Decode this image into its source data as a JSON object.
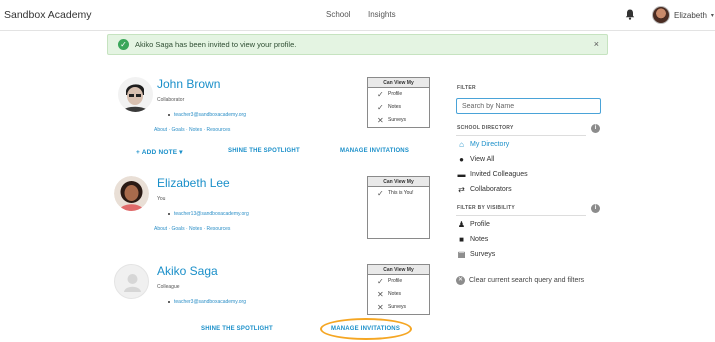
{
  "header": {
    "brand": "Sandbox Academy",
    "nav": [
      "School",
      "Insights"
    ],
    "user_name": "Elizabeth",
    "caret": "▾"
  },
  "alert": {
    "message": "Akiko Saga has been invited to view your profile.",
    "close": "×"
  },
  "people": [
    {
      "name": "John Brown",
      "role": "Collaborator",
      "email": "teacher3@sandboxacademy.org",
      "links": "About · Goals · Notes · Resources",
      "can_view_header": "Can View My",
      "can_view": [
        {
          "label": "Profile",
          "allowed": true
        },
        {
          "label": "Notes",
          "allowed": true
        },
        {
          "label": "Surveys",
          "allowed": false
        }
      ],
      "actions": {
        "add_note": "+ ADD NOTE ▾",
        "spotlight": "SHINE THE SPOTLIGHT",
        "manage": "MANAGE INVITATIONS"
      }
    },
    {
      "name": "Elizabeth Lee",
      "role": "You",
      "email": "teacher13@sandboxacademy.org",
      "links": "About · Goals · Notes · Resources",
      "can_view_header": "Can View My",
      "can_view": [
        {
          "label": "This is You!",
          "allowed": true
        }
      ]
    },
    {
      "name": "Akiko Saga",
      "role": "Colleague",
      "email": "teacher3@sandboxacademy.org",
      "can_view_header": "Can View My",
      "can_view": [
        {
          "label": "Profile",
          "allowed": true
        },
        {
          "label": "Notes",
          "allowed": false
        },
        {
          "label": "Surveys",
          "allowed": false
        }
      ],
      "actions": {
        "spotlight": "SHINE THE SPOTLIGHT",
        "manage": "MANAGE INVITATIONS"
      }
    }
  ],
  "sidebar": {
    "filter_label": "FILTER",
    "search_placeholder": "Search by Name",
    "directory_label": "SCHOOL DIRECTORY",
    "directory_items": [
      {
        "label": "My Directory",
        "icon": "home-icon",
        "active": true
      },
      {
        "label": "View All",
        "icon": "globe-icon",
        "active": false
      },
      {
        "label": "Invited Colleagues",
        "icon": "ticket-icon",
        "active": false
      },
      {
        "label": "Collaborators",
        "icon": "swap-icon",
        "active": false
      }
    ],
    "visibility_label": "FILTER BY VISIBILITY",
    "visibility_items": [
      {
        "label": "Profile",
        "icon": "person-icon"
      },
      {
        "label": "Notes",
        "icon": "folder-icon"
      },
      {
        "label": "Surveys",
        "icon": "map-icon"
      }
    ],
    "info_glyph": "i",
    "clear_label": "Clear current search query and filters"
  },
  "colors": {
    "accent": "#1a8fc9",
    "success_bg": "#e4f4e2",
    "highlight": "#f5a623"
  }
}
